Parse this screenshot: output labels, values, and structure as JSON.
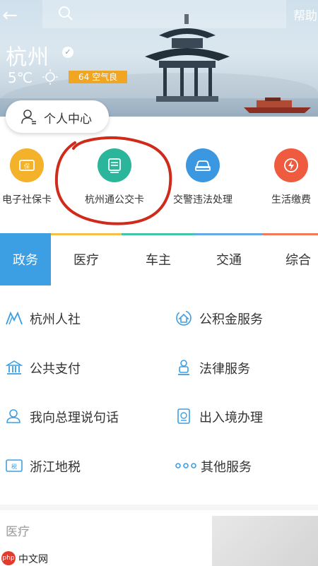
{
  "header": {
    "back_glyph": "←",
    "help_label": "帮助",
    "city": "杭州",
    "temperature": "5℃",
    "aqi_label": "64 空气良",
    "personal_center_label": "个人中心"
  },
  "shortcuts": [
    {
      "label": "电子社保卡",
      "icon": "social-security-card-icon",
      "color": "#f4b12a"
    },
    {
      "label": "杭州通公交卡",
      "icon": "bus-card-icon",
      "color": "#2bb59a"
    },
    {
      "label": "交警违法处理",
      "icon": "car-icon",
      "color": "#3a97e0"
    },
    {
      "label": "生活缴费",
      "icon": "bolt-icon",
      "color": "#ee5b3e"
    }
  ],
  "tabs": [
    {
      "label": "政务",
      "active": true
    },
    {
      "label": "医疗",
      "active": false
    },
    {
      "label": "车主",
      "active": false
    },
    {
      "label": "交通",
      "active": false
    },
    {
      "label": "综合",
      "active": false
    }
  ],
  "services": [
    {
      "label": "杭州人社",
      "icon": "hangzhou-hr-icon"
    },
    {
      "label": "公积金服务",
      "icon": "housing-fund-icon"
    },
    {
      "label": "公共支付",
      "icon": "bank-icon"
    },
    {
      "label": "法律服务",
      "icon": "law-icon"
    },
    {
      "label": "我向总理说句话",
      "icon": "user-message-icon"
    },
    {
      "label": "出入境办理",
      "icon": "passport-icon"
    },
    {
      "label": "浙江地税",
      "icon": "tax-icon"
    },
    {
      "label": "其他服务",
      "icon": "more-dots-icon"
    }
  ],
  "sections": {
    "medical_title": "医疗"
  },
  "watermark": {
    "circle_text": "php",
    "text": "中文网"
  },
  "colors": {
    "accent": "#3d9fe3",
    "annotation": "#d02a1a",
    "aqi_badge": "#f0a623"
  }
}
